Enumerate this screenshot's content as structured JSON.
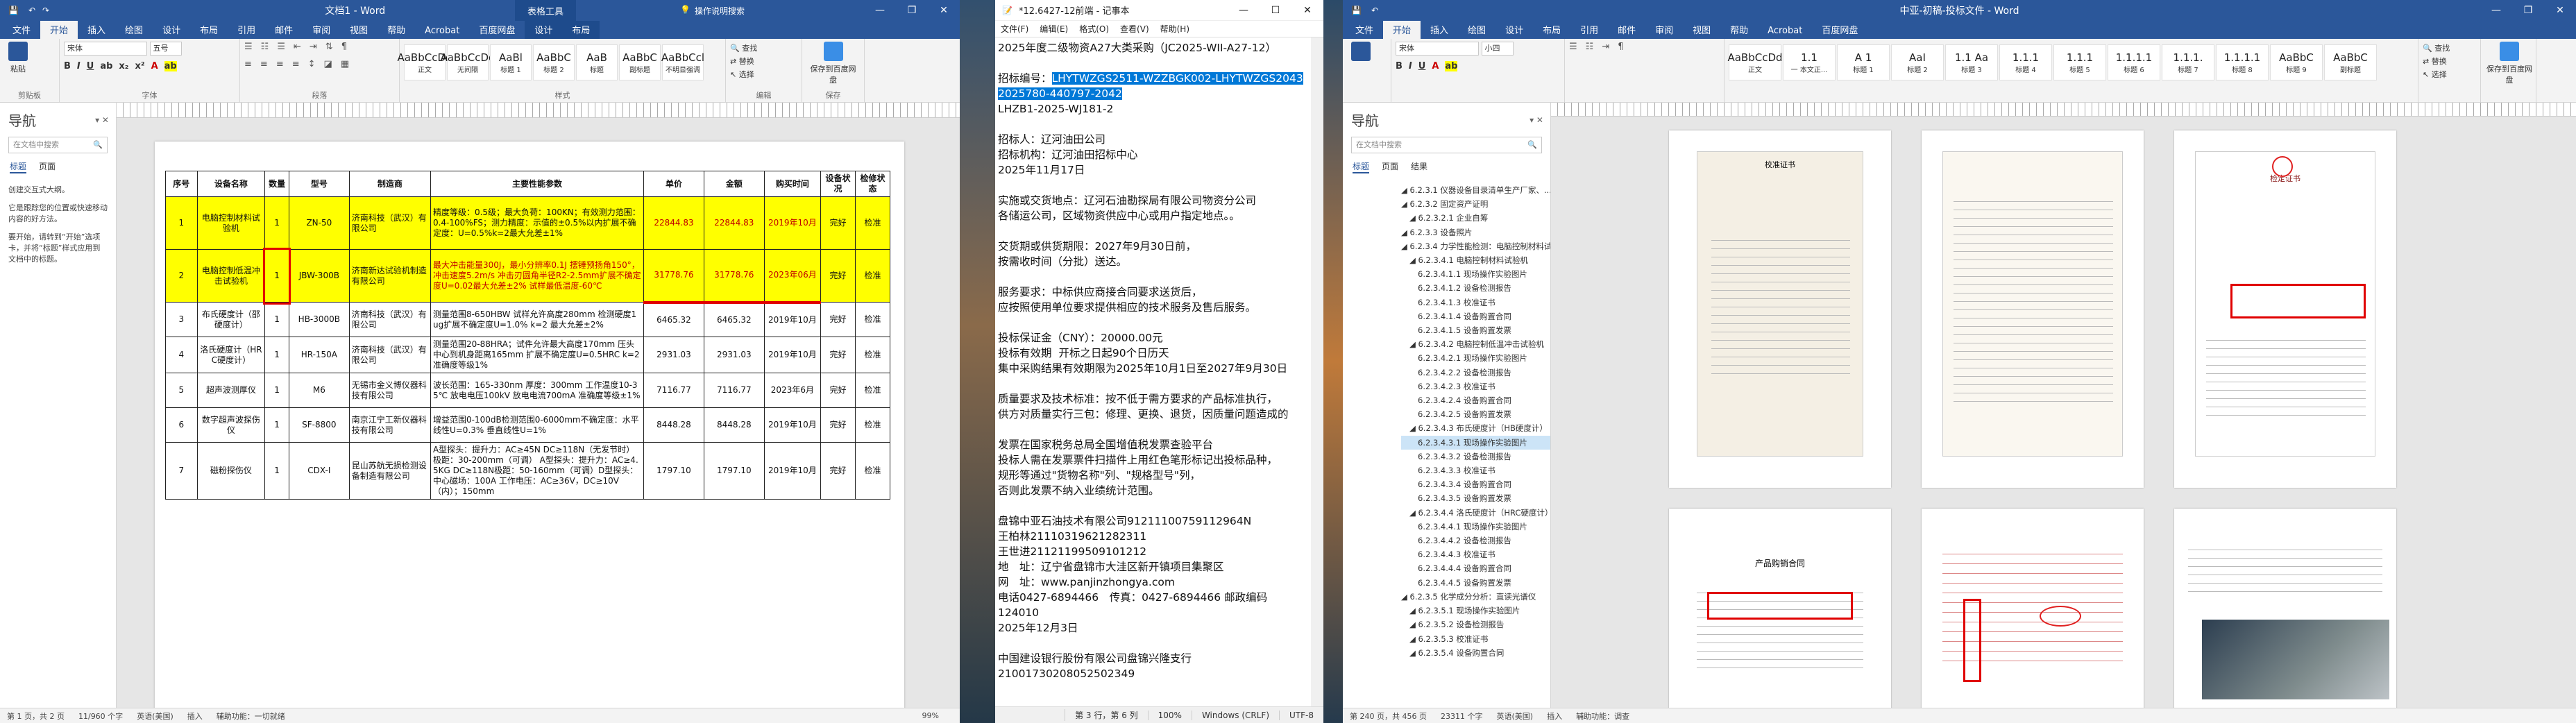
{
  "word1": {
    "title": "文档1 - Word",
    "context_tab_group": "表格工具",
    "tabs": [
      "文件",
      "开始",
      "插入",
      "绘图",
      "设计",
      "布局",
      "引用",
      "邮件",
      "审阅",
      "视图",
      "帮助",
      "Acrobat",
      "百度网盘",
      "设计",
      "布局"
    ],
    "tell_me": "操作说明搜索",
    "ribbon": {
      "paste": "粘贴",
      "clipboard": "剪贴板",
      "font_name": "宋体",
      "font_size": "五号",
      "font_group": "字体",
      "paragraph_group": "段落",
      "styles": [
        {
          "preview": "AaBbCcDd",
          "name": "正文"
        },
        {
          "preview": "AaBbCcDd",
          "name": "无间隔"
        },
        {
          "preview": "AaBl",
          "name": "标题 1"
        },
        {
          "preview": "AaBbC",
          "name": "标题 2"
        },
        {
          "preview": "AaB",
          "name": "标题"
        },
        {
          "preview": "AaBbC",
          "name": "副标题"
        },
        {
          "preview": "AaBbCcl",
          "name": "不明显强调"
        }
      ],
      "styles_group": "样式",
      "find": "查找",
      "replace": "替换",
      "select": "选择",
      "editing_group": "编辑",
      "baidu_save": "保存到百度网盘",
      "save_group": "保存"
    },
    "nav": {
      "heading": "导航",
      "search_placeholder": "在文档中搜索",
      "tabs": [
        "标题",
        "页面"
      ],
      "help_text": [
        "创建交互式大纲。",
        "它是跟踪您的位置或快速移动内容的好方法。",
        "要开始，请转到“开始”选项卡，并将“标题”样式应用到文档中的标题。"
      ]
    },
    "table": {
      "headers": [
        "序号",
        "设备名称",
        "数量",
        "型号",
        "制造商",
        "主要性能参数",
        "单价",
        "金额",
        "购买时间",
        "设备状况",
        "检修状态"
      ],
      "rows": [
        [
          "1",
          "电脑控制材料试验机",
          "1",
          "ZN-50",
          "济南科技（武汉）有限公司",
          "精度等级：0.5级；最大负荷：100KN；有效测力范围：0.4-100%FS；测力精度：示值的±0.5%以内扩展不确定度：U=0.5%k=2最大允差±1%",
          "22844.83",
          "22844.83",
          "2019年10月",
          "完好",
          "检准"
        ],
        [
          "2",
          "电脑控制低温冲击试验机",
          "1",
          "JBW-300B",
          "济南新达试验机制造有限公司",
          "最大冲击能量300J，最小分辨率0.1J 摆锤预扬角150°，冲击速度5.2m/s 冲击刃圆角半径R2-2.5mm扩展不确定度U=0.02最大允差±2% 试样最低温度-60℃",
          "31778.76",
          "31778.76",
          "2023年06月",
          "完好",
          "检准"
        ],
        [
          "3",
          "布氏硬度计（邵硬度计）",
          "1",
          "HB-3000B",
          "济南科技（武汉）有限公司",
          "测量范围8-650HBW 试样允许高度280mm 检测硬度1ug扩展不确定度U=1.0% k=2 最大允差±2%",
          "6465.32",
          "6465.32",
          "2019年10月",
          "完好",
          "检准"
        ],
        [
          "4",
          "洛氏硬度计（HRC硬度计）",
          "1",
          "HR-150A",
          "济南科技（武汉）有限公司",
          "测量范围20-88HRA；试件允许最大高度170mm 压头中心到机身距离165mm 扩展不确定度U=0.5HRC k=2 准确度等级1%",
          "2931.03",
          "2931.03",
          "2019年10月",
          "完好",
          "检准"
        ],
        [
          "5",
          "超声波测厚仪",
          "1",
          "M6",
          "无锡市金义博仪器科技有限公司",
          "波长范围：165-330nm 厚度：300mm 工作温度10-35℃ 放电电压100kV 放电电流700mA 准确度等级±1%",
          "7116.77",
          "7116.77",
          "2023年6月",
          "完好",
          "检准"
        ],
        [
          "6",
          "数字超声波探伤仪",
          "1",
          "SF-8800",
          "南京江宁工新仪器科技有限公司",
          "增益范围0-100dB检测范围0-6000mm不确定度：水平线性U=0.3% 垂直线性U=1%",
          "8448.28",
          "8448.28",
          "2019年10月",
          "完好",
          "检准"
        ],
        [
          "7",
          "磁粉探伤仪",
          "1",
          "CDX-I",
          "昆山苏航无损检测设备制造有限公司",
          "A型探头：提升力：AC≥45N DC≥118N（无发节时）极距：30-200mm（可调） A型探头：提升力：AC≥4.5KG DC≥118N极距：50-160mm（可调）D型探头：中心磁场：100A 工作电压：AC≥36V，DC≥10V（内）；150mm",
          "1797.10",
          "1797.10",
          "2019年10月",
          "完好",
          "检准"
        ]
      ]
    },
    "status": {
      "page": "第 1 页，共 2 页",
      "words": "11/960 个字",
      "lang": "英语(美国)",
      "insert": "插入",
      "accessibility": "辅助功能：一切就绪",
      "zoom": "99%"
    }
  },
  "notepad": {
    "title": "*12.6427-12前端 - 记事本",
    "menu": [
      "文件(F)",
      "编辑(E)",
      "格式(O)",
      "查看(V)",
      "帮助(H)"
    ],
    "lines": [
      "2025年度二级物资A27大类采购（JC2025-WII-A27-12）",
      "",
      "招标编号：LHYTWZGS2511-WZZBGK002-LHYTWZGS2043",
      "2025780-440797-2042",
      "LHZB1-2025-WJ181-2",
      "",
      "招标人：辽河油田公司",
      "招标机构：辽河油田招标中心",
      "2025年11月17日",
      "",
      "实施或交货地点：辽河石油勘探局有限公司物资分公司",
      "各储运公司，区域物资供应中心或用户指定地点。。",
      "",
      "交货期或供货期限：2027年9月30日前，",
      "按需收时间（分批）送达。",
      "",
      "服务要求：中标供应商接合同要求送货后，",
      "应按照使用单位要求提供相应的技术服务及售后服务。",
      "",
      "投标保证金（CNY）：20000.00元",
      "投标有效期  开标之日起90个日历天",
      "集中采购结果有效期限为2025年10月1日至2027年9月30日",
      "",
      "质量要求及技术标准：按不低于需方要求的产品标准执行，",
      "供方对质量实行三包：修理、更换、退货，因质量问题造成的",
      "",
      "发票在国家税务总局全国增值税发票查验平台",
      "投标人需在发票票件扫描件上用红色笔形标记出投标品种，",
      "规形等通过\"货物名称\"列、\"规格型号\"列，",
      "否则此发票不纳入业绩统计范围。",
      "",
      "盘锦中亚石油技术有限公司91211100759112964N",
      "王柏林21110319621282311",
      "王世进21121199509101212",
      "地　址：辽宁省盘锦市大洼区新开镇项目集聚区",
      "网　址：www.panjinzhongya.com",
      "电话0427-6894466　传真：0427-6894466 邮政编码124010",
      "2025年12月3日",
      "",
      "中国建设银行股份有限公司盘锦兴隆支行",
      "21001730208052502349"
    ],
    "selected_line_index": 2,
    "status": {
      "pos": "第 3 行，第 6 列",
      "zoom": "100%",
      "eol": "Windows (CRLF)",
      "enc": "UTF-8"
    }
  },
  "word2": {
    "title": "中亚-初稿-投标文件 - Word",
    "tabs": [
      "文件",
      "开始",
      "插入",
      "绘图",
      "设计",
      "布局",
      "引用",
      "邮件",
      "审阅",
      "视图",
      "帮助",
      "Acrobat",
      "百度网盘"
    ],
    "tell_me": "操作说明搜索",
    "ribbon": {
      "font_name": "宋体",
      "font_size": "小四",
      "styles": [
        {
          "preview": "AaBbCcDd",
          "name": "正文"
        },
        {
          "preview": "1.1",
          "name": "一 本文正..."
        },
        {
          "preview": "A 1",
          "name": "标题 1"
        },
        {
          "preview": "AaI",
          "name": "标题 2"
        },
        {
          "preview": "1.1 Aa",
          "name": "标题 3"
        },
        {
          "preview": "1.1.1",
          "name": "标题 4"
        },
        {
          "preview": "1.1.1",
          "name": "标题 5"
        },
        {
          "preview": "1.1.1.1",
          "name": "标题 6"
        },
        {
          "preview": "1.1.1.",
          "name": "标题 7"
        },
        {
          "preview": "1.1.1.1",
          "name": "标题 8"
        },
        {
          "preview": "AaBbC",
          "name": "标题 9"
        },
        {
          "preview": "AaBbC",
          "name": "副标题"
        }
      ],
      "find": "查找",
      "replace": "替换",
      "select": "选择",
      "baidu_save": "保存到百度网盘"
    },
    "nav": {
      "heading": "导航",
      "search_placeholder": "在文档中搜索",
      "tabs": [
        "标题",
        "页面",
        "结果"
      ],
      "toc": [
        {
          "t": "6.2.3.1 仪器设备目录清单生产厂家、...",
          "lv": 0
        },
        {
          "t": "6.2.3.2 固定资产证明",
          "lv": 0
        },
        {
          "t": "6.2.3.2.1 企业自筹",
          "lv": 1
        },
        {
          "t": "6.2.3.3 设备照片",
          "lv": 0
        },
        {
          "t": "6.2.3.4 力学性能检测：电脑控制材料试验机",
          "lv": 0
        },
        {
          "t": "6.2.3.4.1 电脑控制材料试验机",
          "lv": 1
        },
        {
          "t": "6.2.3.4.1.1 现场操作实验图片",
          "lv": 2
        },
        {
          "t": "6.2.3.4.1.2 设备检测报告",
          "lv": 2
        },
        {
          "t": "6.2.3.4.1.3 校准证书",
          "lv": 2
        },
        {
          "t": "6.2.3.4.1.4 设备购置合同",
          "lv": 2
        },
        {
          "t": "6.2.3.4.1.5 设备购置发票",
          "lv": 2
        },
        {
          "t": "6.2.3.4.2 电脑控制低温冲击试验机",
          "lv": 1
        },
        {
          "t": "6.2.3.4.2.1 现场操作实验图片",
          "lv": 2
        },
        {
          "t": "6.2.3.4.2.2 设备检测报告",
          "lv": 2
        },
        {
          "t": "6.2.3.4.2.3 校准证书",
          "lv": 2
        },
        {
          "t": "6.2.3.4.2.4 设备购置合同",
          "lv": 2
        },
        {
          "t": "6.2.3.4.2.5 设备购置发票",
          "lv": 2
        },
        {
          "t": "6.2.3.4.3 布氏硬度计（HB硬度计）",
          "lv": 1
        },
        {
          "t": "6.2.3.4.3.1 现场操作实验图片",
          "lv": 2,
          "hl": true
        },
        {
          "t": "6.2.3.4.3.2 设备检测报告",
          "lv": 2
        },
        {
          "t": "6.2.3.4.3.3 校准证书",
          "lv": 2
        },
        {
          "t": "6.2.3.4.3.4 设备购置合同",
          "lv": 2
        },
        {
          "t": "6.2.3.4.3.5 设备购置发票",
          "lv": 2
        },
        {
          "t": "6.2.3.4.4 洛氏硬度计（HRC硬度计）",
          "lv": 1
        },
        {
          "t": "6.2.3.4.4.1 现场操作实验图片",
          "lv": 2
        },
        {
          "t": "6.2.3.4.4.2 设备检测报告",
          "lv": 2
        },
        {
          "t": "6.2.3.4.4.3 校准证书",
          "lv": 2
        },
        {
          "t": "6.2.3.4.4.4 设备购置合同",
          "lv": 2
        },
        {
          "t": "6.2.3.4.4.5 设备购置发票",
          "lv": 2
        },
        {
          "t": "6.2.3.5 化学成分分析：直读光谱仪",
          "lv": 0
        },
        {
          "t": "6.2.3.5.1 现场操作实验图片",
          "lv": 1
        },
        {
          "t": "6.2.3.5.2 设备检测报告",
          "lv": 1
        },
        {
          "t": "6.2.3.5.3 校准证书",
          "lv": 1
        },
        {
          "t": "6.2.3.5.4 设备购置合同",
          "lv": 1
        }
      ]
    },
    "page_titles": [
      "校准证书",
      "检定证书",
      "产品购销合同"
    ],
    "status": {
      "page": "第 240 页，共 456 页",
      "words": "23311 个字",
      "lang": "英语(美国)",
      "insert": "插入",
      "accessibility": "辅助功能：调查"
    }
  }
}
